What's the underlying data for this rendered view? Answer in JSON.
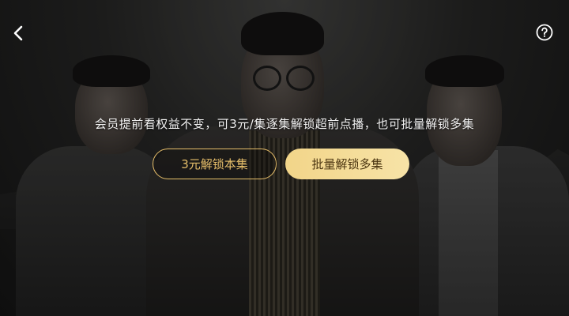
{
  "header": {
    "back_icon": "chevron-left-icon",
    "help_icon": "question-circle-icon"
  },
  "unlock": {
    "message": "会员提前看权益不变，可3元/集逐集解锁超前点播，也可批量解锁多集",
    "single_label": "3元解锁本集",
    "batch_label": "批量解锁多集"
  },
  "colors": {
    "gold": "#e6be6a",
    "gold_button": "#f2d589",
    "batch_text": "#4a3410"
  }
}
